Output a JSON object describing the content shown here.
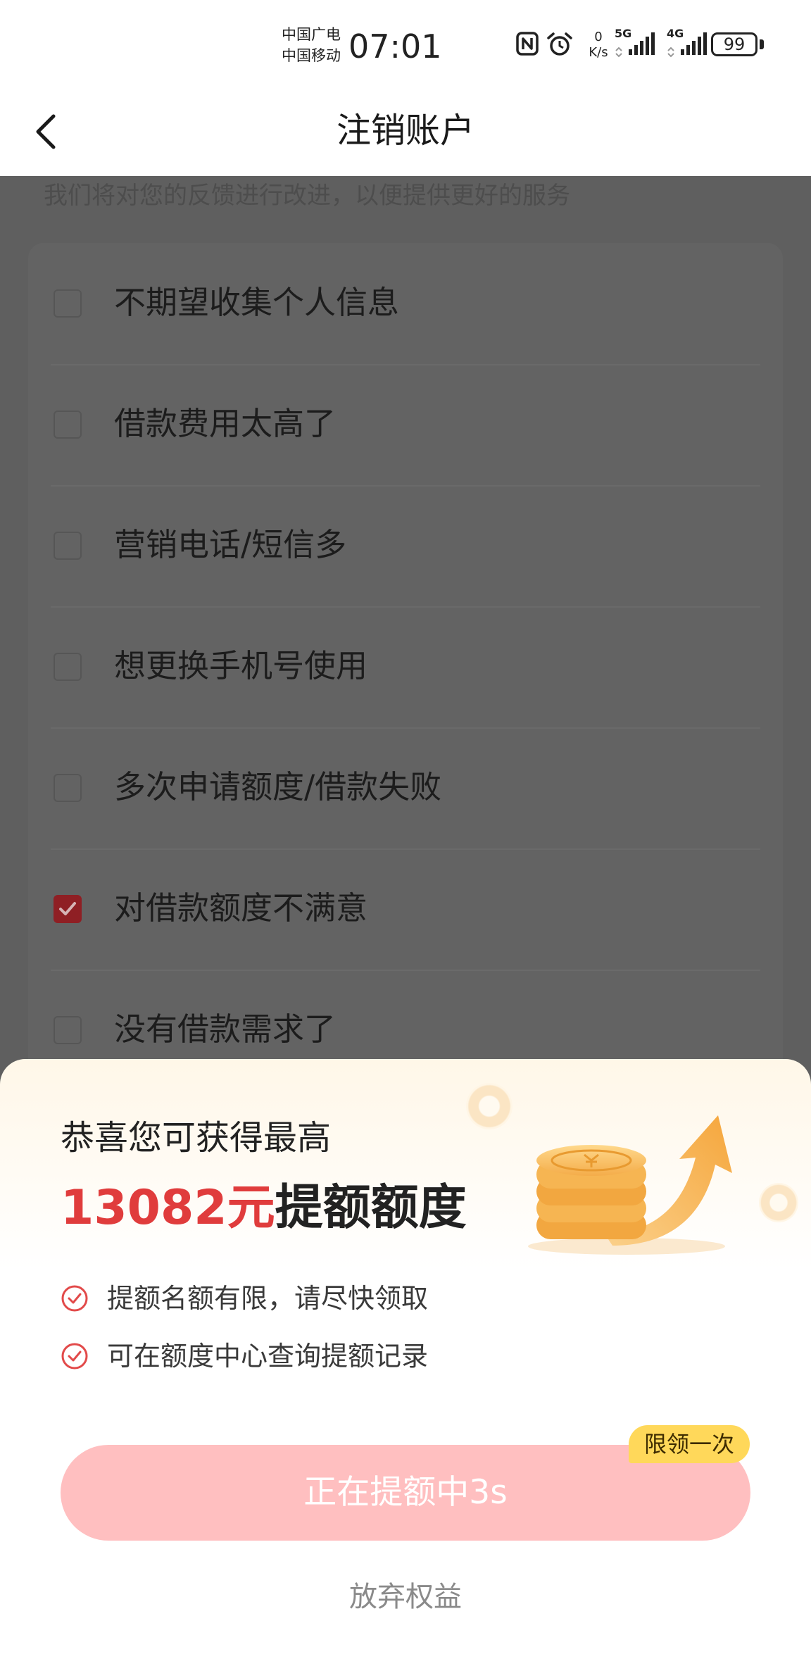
{
  "status_bar": {
    "carrier_1": "中国广电",
    "carrier_2": "中国移动",
    "time": "07:01",
    "net_speed_value": "0",
    "net_speed_unit": "K/s",
    "signal_1": "5G",
    "signal_2": "4G",
    "battery": "99",
    "icons": [
      "nfc-icon",
      "alarm-icon",
      "signal-5g-icon",
      "signal-4g-icon",
      "battery-icon"
    ]
  },
  "header": {
    "title": "注销账户",
    "back_icon": "chevron-left-icon"
  },
  "page": {
    "hint": "我们将对您的反馈进行改进，以便提供更好的服务",
    "reasons": [
      {
        "label": "不期望收集个人信息",
        "checked": false
      },
      {
        "label": "借款费用太高了",
        "checked": false
      },
      {
        "label": "营销电话/短信多",
        "checked": false
      },
      {
        "label": "想更换手机号使用",
        "checked": false
      },
      {
        "label": "多次申请额度/借款失败",
        "checked": false
      },
      {
        "label": "对借款额度不满意",
        "checked": true
      },
      {
        "label": "没有借款需求了",
        "checked": false
      }
    ]
  },
  "sheet": {
    "congrats": "恭喜您可获得最高",
    "amount": "13082元",
    "amount_suffix": "提额额度",
    "perks": [
      "提额名额有限，请尽快领取",
      "可在额度中心查询提额记录"
    ],
    "cta_label": "正在提额中3s",
    "badge": "限领一次",
    "giveup": "放弃权益",
    "illustration": "coins-arrow-illustration"
  },
  "colors": {
    "accent_red": "#e03c3c",
    "cta_bg": "#ffbfc0",
    "badge_bg": "#ffd85a",
    "checkbox_checked": "#8f1f24",
    "overlay_bg": "#5f5f5f"
  }
}
